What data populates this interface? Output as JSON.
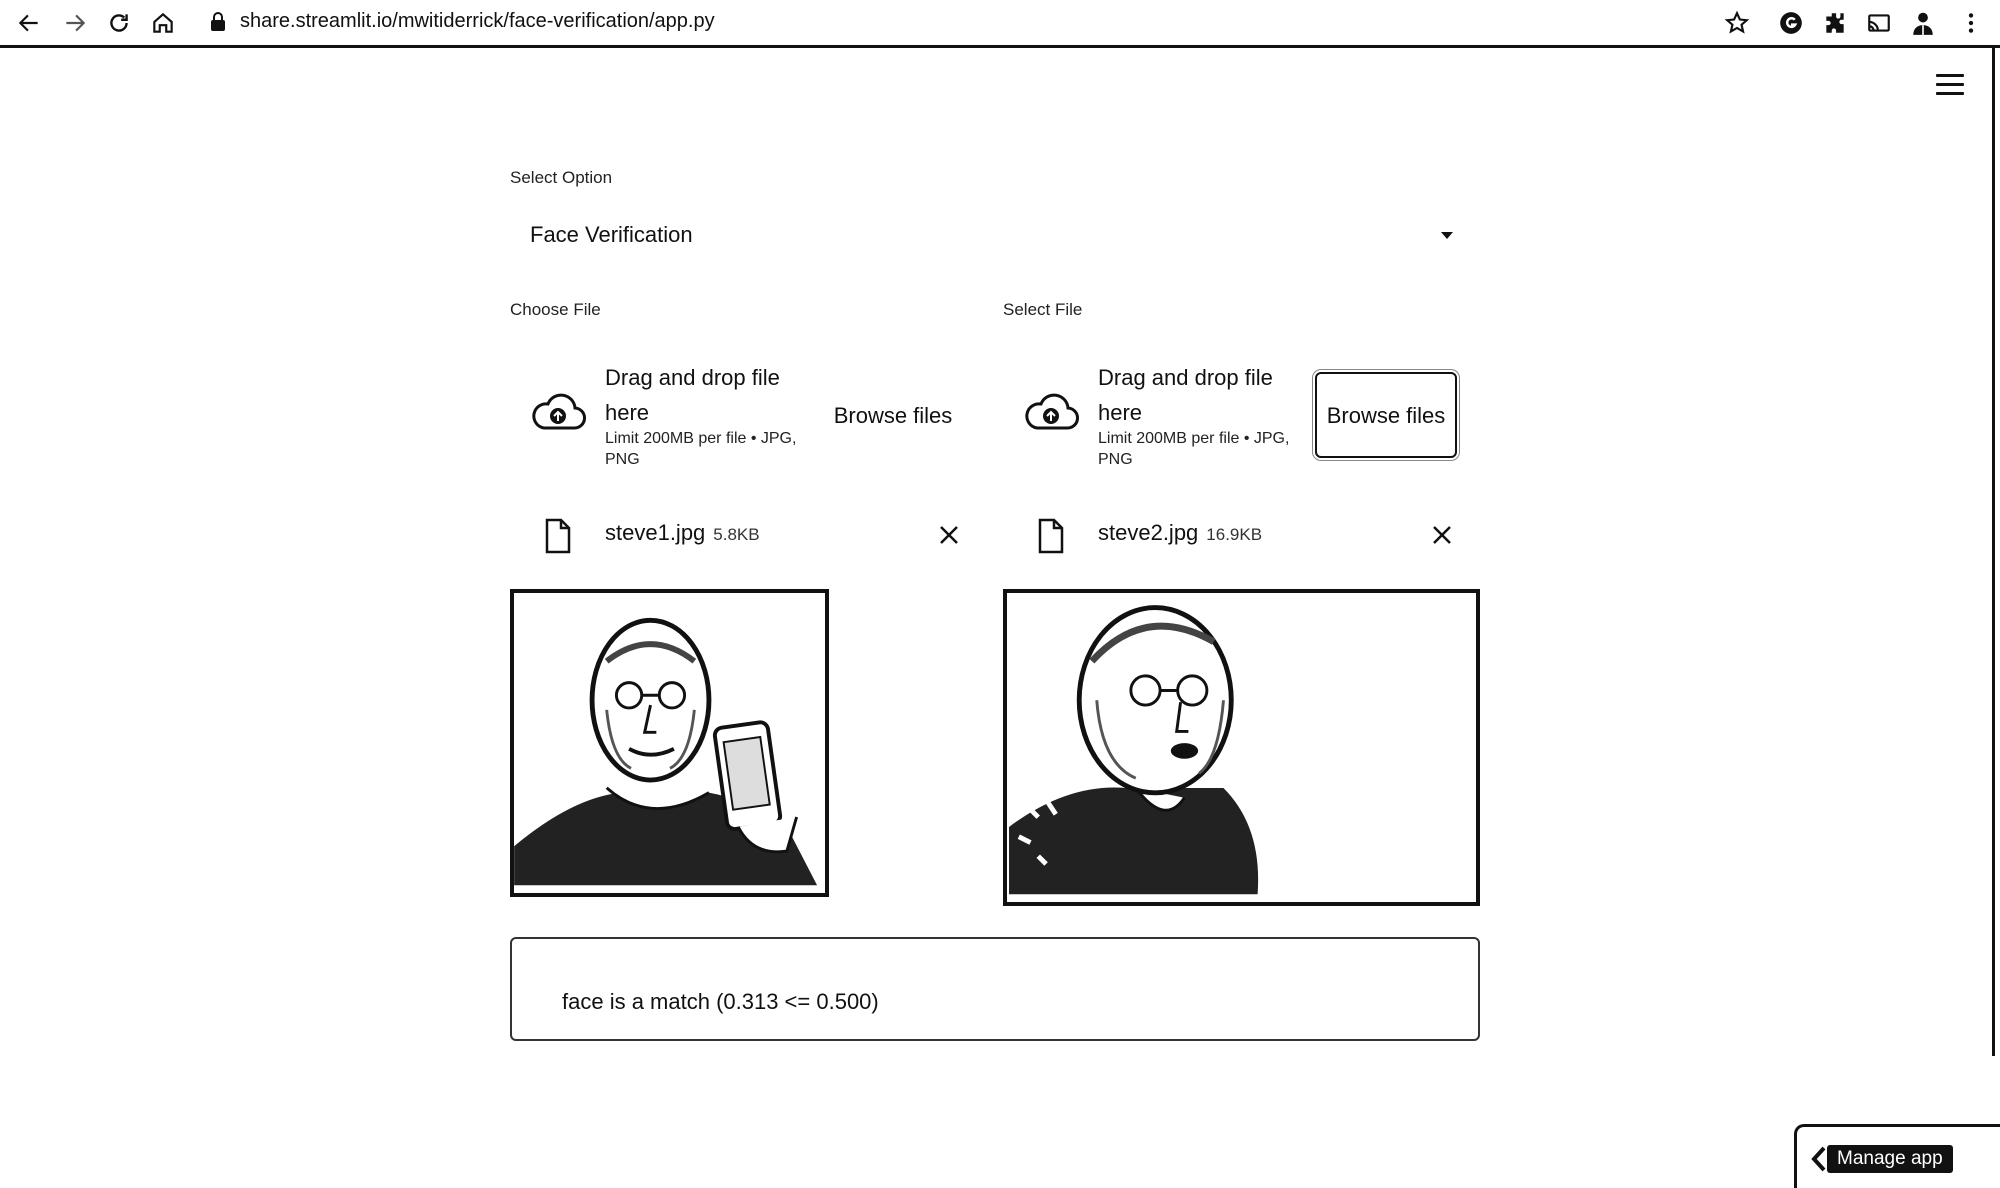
{
  "browser": {
    "url": "share.streamlit.io/mwitiderrick/face-verification/app.py",
    "nav_icons": [
      "back-arrow-icon",
      "forward-arrow-icon",
      "reload-icon",
      "home-icon"
    ],
    "extension_icons": [
      "bookmark-star-icon",
      "grammarly-icon",
      "extensions-puzzle-icon",
      "cast-icon",
      "profile-avatar-icon",
      "more-vert-icon"
    ]
  },
  "app": {
    "menu_icon": "hamburger-menu-icon",
    "select": {
      "label": "Select Option",
      "value": "Face Verification"
    },
    "uploaders": [
      {
        "label": "Choose File",
        "drop_text": "Drag and drop file here",
        "limit_text": "Limit 200MB per file • JPG, PNG",
        "browse_label": "Browse files",
        "file": {
          "name": "steve1.jpg",
          "size": "5.8KB"
        }
      },
      {
        "label": "Select File",
        "drop_text": "Drag and drop file here",
        "limit_text": "Limit 200MB per file • JPG, PNG",
        "browse_label": "Browse files",
        "file": {
          "name": "steve2.jpg",
          "size": "16.9KB"
        }
      }
    ],
    "result": "face is a match (0.313 <= 0.500)",
    "manage_app": "Manage app"
  },
  "colors": {
    "ink": "#111111",
    "background": "#ffffff"
  }
}
